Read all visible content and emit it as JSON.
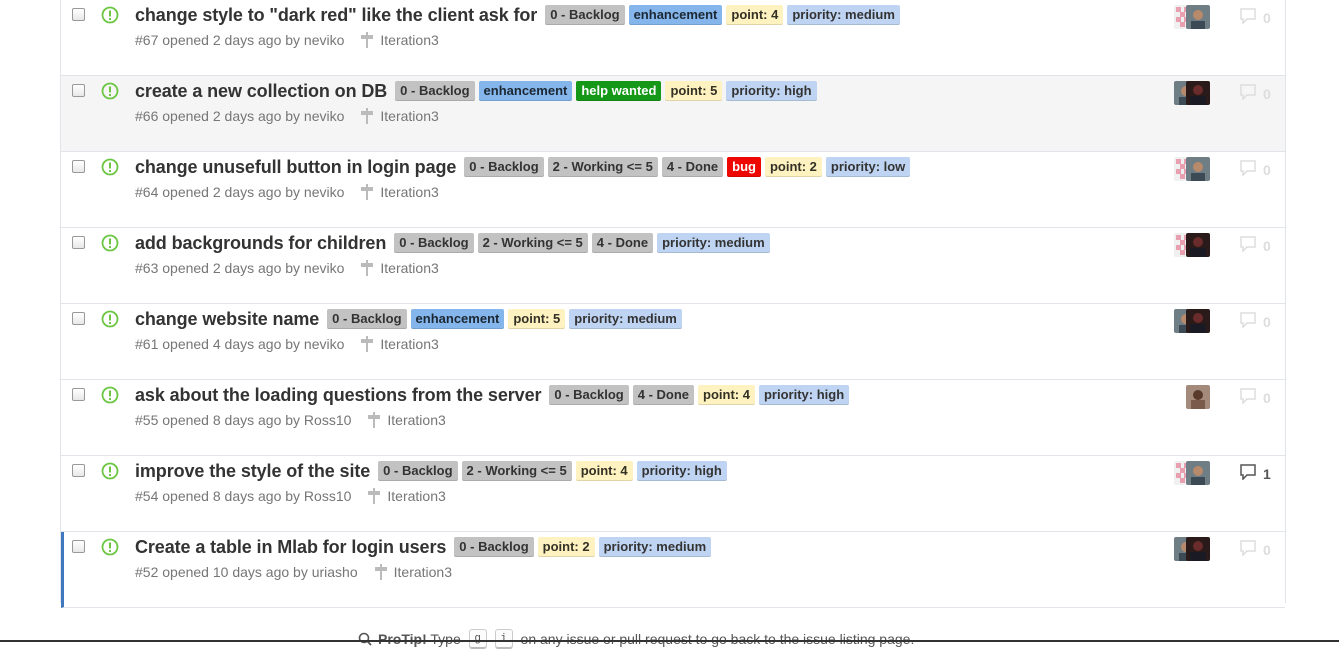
{
  "issues": [
    {
      "title": "change style to \"dark red\" like the client ask for",
      "meta": "#67 opened 2 days ago by neviko",
      "milestone": "Iteration3",
      "labels": [
        {
          "text": "0 - Backlog",
          "bg": "#c2c2c2",
          "fg": "#333333"
        },
        {
          "text": "enhancement",
          "bg": "#84b6eb",
          "fg": "#1c2733"
        },
        {
          "text": "point: 4",
          "bg": "#fef2c0",
          "fg": "#333026"
        },
        {
          "text": "priority: medium",
          "bg": "#bfd4f2",
          "fg": "#333333"
        }
      ],
      "avatars": [
        "identicon-pink",
        "photo-person"
      ],
      "comments": "0",
      "comments_active": false
    },
    {
      "title": "create a new collection on DB",
      "meta": "#66 opened 2 days ago by neviko",
      "milestone": "Iteration3",
      "labels": [
        {
          "text": "0 - Backlog",
          "bg": "#c2c2c2",
          "fg": "#333333"
        },
        {
          "text": "enhancement",
          "bg": "#84b6eb",
          "fg": "#1c2733"
        },
        {
          "text": "help wanted",
          "bg": "#159818",
          "fg": "#ffffff"
        },
        {
          "text": "point: 5",
          "bg": "#fef2c0",
          "fg": "#333026"
        },
        {
          "text": "priority: high",
          "bg": "#bfd4f2",
          "fg": "#333333"
        }
      ],
      "avatars": [
        "photo-person",
        "photo-dark"
      ],
      "comments": "0",
      "comments_active": false
    },
    {
      "title": "change unusefull button in login page",
      "meta": "#64 opened 2 days ago by neviko",
      "milestone": "Iteration3",
      "labels": [
        {
          "text": "0 - Backlog",
          "bg": "#c2c2c2",
          "fg": "#333333"
        },
        {
          "text": "2 - Working <= 5",
          "bg": "#c2c2c2",
          "fg": "#333333"
        },
        {
          "text": "4 - Done",
          "bg": "#c2c2c2",
          "fg": "#333333"
        },
        {
          "text": "bug",
          "bg": "#ee0701",
          "fg": "#ffffff"
        },
        {
          "text": "point: 2",
          "bg": "#fef2c0",
          "fg": "#333026"
        },
        {
          "text": "priority: low",
          "bg": "#bfd4f2",
          "fg": "#333333"
        }
      ],
      "avatars": [
        "identicon-pink",
        "photo-person"
      ],
      "comments": "0",
      "comments_active": false
    },
    {
      "title": "add backgrounds for children",
      "meta": "#63 opened 2 days ago by neviko",
      "milestone": "Iteration3",
      "labels": [
        {
          "text": "0 - Backlog",
          "bg": "#c2c2c2",
          "fg": "#333333"
        },
        {
          "text": "2 - Working <= 5",
          "bg": "#c2c2c2",
          "fg": "#333333"
        },
        {
          "text": "4 - Done",
          "bg": "#c2c2c2",
          "fg": "#333333"
        },
        {
          "text": "priority: medium",
          "bg": "#bfd4f2",
          "fg": "#333333"
        }
      ],
      "avatars": [
        "identicon-pink",
        "photo-dark"
      ],
      "comments": "0",
      "comments_active": false
    },
    {
      "title": "change website name",
      "meta": "#61 opened 4 days ago by neviko",
      "milestone": "Iteration3",
      "labels": [
        {
          "text": "0 - Backlog",
          "bg": "#c2c2c2",
          "fg": "#333333"
        },
        {
          "text": "enhancement",
          "bg": "#84b6eb",
          "fg": "#1c2733"
        },
        {
          "text": "point: 5",
          "bg": "#fef2c0",
          "fg": "#333026"
        },
        {
          "text": "priority: medium",
          "bg": "#bfd4f2",
          "fg": "#333333"
        }
      ],
      "avatars": [
        "photo-person",
        "photo-dark"
      ],
      "comments": "0",
      "comments_active": false
    },
    {
      "title": "ask about the loading questions from the server",
      "meta": "#55 opened 8 days ago by Ross10",
      "milestone": "Iteration3",
      "labels": [
        {
          "text": "0 - Backlog",
          "bg": "#c2c2c2",
          "fg": "#333333"
        },
        {
          "text": "4 - Done",
          "bg": "#c2c2c2",
          "fg": "#333333"
        },
        {
          "text": "point: 4",
          "bg": "#fef2c0",
          "fg": "#333026"
        },
        {
          "text": "priority: high",
          "bg": "#bfd4f2",
          "fg": "#333333"
        }
      ],
      "avatars": [
        "photo-brown"
      ],
      "comments": "0",
      "comments_active": false
    },
    {
      "title": "improve the style of the site",
      "meta": "#54 opened 8 days ago by Ross10",
      "milestone": "Iteration3",
      "labels": [
        {
          "text": "0 - Backlog",
          "bg": "#c2c2c2",
          "fg": "#333333"
        },
        {
          "text": "2 - Working <= 5",
          "bg": "#c2c2c2",
          "fg": "#333333"
        },
        {
          "text": "point: 4",
          "bg": "#fef2c0",
          "fg": "#333026"
        },
        {
          "text": "priority: high",
          "bg": "#bfd4f2",
          "fg": "#333333"
        }
      ],
      "avatars": [
        "identicon-pink",
        "photo-person"
      ],
      "comments": "1",
      "comments_active": true
    },
    {
      "title": "Create a table in Mlab for login users",
      "meta": "#52 opened 10 days ago by uriasho",
      "milestone": "Iteration3",
      "labels": [
        {
          "text": "0 - Backlog",
          "bg": "#c2c2c2",
          "fg": "#333333"
        },
        {
          "text": "point: 2",
          "bg": "#fef2c0",
          "fg": "#333026"
        },
        {
          "text": "priority: medium",
          "bg": "#bfd4f2",
          "fg": "#333333"
        }
      ],
      "avatars": [
        "photo-person",
        "photo-dark"
      ],
      "comments": "0",
      "comments_active": false
    }
  ],
  "hovered_index": 1,
  "selected_index": 7,
  "protip": {
    "lead": "ProTip!",
    "text_before": " Type ",
    "key1": "g",
    "key2": "i",
    "text_after": " on any issue or pull request to go back to the issue listing page."
  },
  "colors": {
    "open_icon": "#6cc644",
    "selected_bar": "#4078c0"
  }
}
